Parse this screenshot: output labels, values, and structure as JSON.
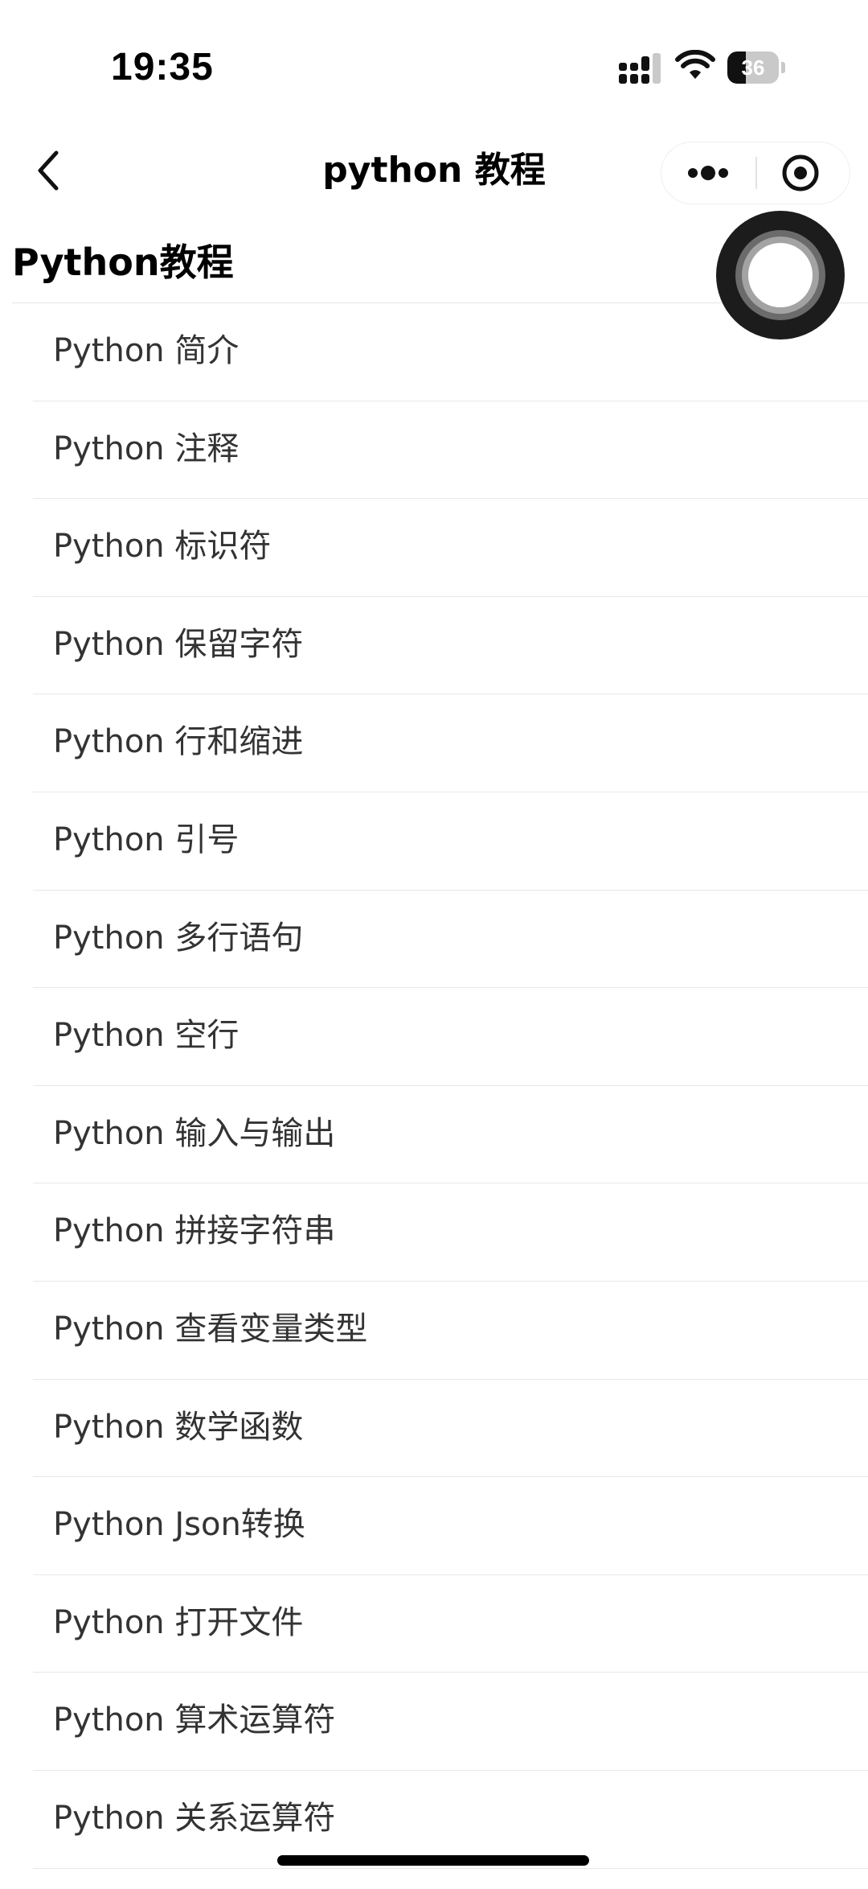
{
  "status_bar": {
    "time": "19:35",
    "battery_level": "36",
    "battery_fraction": 0.36,
    "icons": [
      "signal-icon",
      "wifi-icon",
      "battery-icon"
    ]
  },
  "nav": {
    "title": "python 教程",
    "icons": [
      "back-icon",
      "more-icon",
      "close-miniprogram-icon"
    ]
  },
  "section": {
    "title": "Python教程"
  },
  "list": {
    "items": [
      {
        "label": "Python 简介"
      },
      {
        "label": "Python 注释"
      },
      {
        "label": "Python 标识符"
      },
      {
        "label": "Python 保留字符"
      },
      {
        "label": "Python 行和缩进"
      },
      {
        "label": "Python 引号"
      },
      {
        "label": "Python 多行语句"
      },
      {
        "label": "Python 空行"
      },
      {
        "label": "Python 输入与输出"
      },
      {
        "label": "Python 拼接字符串"
      },
      {
        "label": "Python 查看变量类型"
      },
      {
        "label": "Python 数学函数"
      },
      {
        "label": "Python Json转换"
      },
      {
        "label": "Python 打开文件"
      },
      {
        "label": "Python 算术运算符"
      },
      {
        "label": "Python 关系运算符"
      }
    ]
  },
  "floating_button": {
    "icon": "record-button-icon"
  },
  "colors": {
    "background": "#ffffff",
    "text_primary": "#000000",
    "text_list": "#333333",
    "divider": "#e8e8e8"
  }
}
